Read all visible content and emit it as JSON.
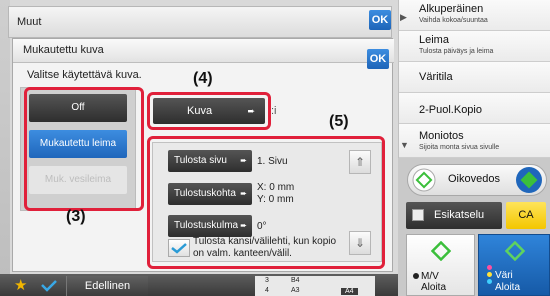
{
  "top_bar": {
    "title": "Muut",
    "ok": "OK"
  },
  "dialog": {
    "title": "Mukautettu kuva",
    "ok": "OK",
    "instruction": "Valitse käytettävä kuva.",
    "options": {
      "off": "Off",
      "custom_stamp": "Mukautettu leima",
      "watermark": "Muk. vesileima"
    },
    "kuva_button": "Kuva",
    "kuva_side": ":i",
    "settings": {
      "print_page_label": "Tulosta sivu",
      "print_page_value": "1. Sivu",
      "print_position_label": "Tulostuskohta",
      "print_position_x": "X: 0 mm",
      "print_position_y": "Y: 0 mm",
      "print_angle_label": "Tulostuskulma",
      "print_angle_value": "0°",
      "checkbox_text": "Tulosta kansi/välilehti, kun kopio on valm. kanteen/välil."
    }
  },
  "callouts": {
    "c3": "(3)",
    "c4": "(4)",
    "c5": "(5)"
  },
  "right_menu": {
    "items": [
      {
        "label": "Alkuperäinen",
        "sub": "Vaihda kokoa/suuntaa"
      },
      {
        "label": "Leima",
        "sub": "Tulosta päiväys ja leima"
      },
      {
        "label": "Väritila",
        "sub": ""
      },
      {
        "label": "2-Puol.Kopio",
        "sub": ""
      },
      {
        "label": "Moniotos",
        "sub": "Sijoita monta sivua sivulle"
      }
    ]
  },
  "controls": {
    "preview_toggle": "Oikovedos",
    "preview_button": "Esikatselu",
    "ca_button": "CA",
    "start_mono": {
      "line1": "M/V",
      "line2": "Aloita"
    },
    "start_color": {
      "line1": "Väri",
      "line2": "Aloita"
    }
  },
  "bottom_bar": {
    "back": "Edellinen",
    "paper": {
      "r1c1": "3",
      "r1c2": "B4",
      "r2c1": "4",
      "r2c2": "A3",
      "current": "A4"
    }
  },
  "colors": {
    "accent_blue": "#1f66bb",
    "callout_red": "#e0203a",
    "ca_yellow": "#f3c600",
    "start_green": "#3bbf3b"
  }
}
